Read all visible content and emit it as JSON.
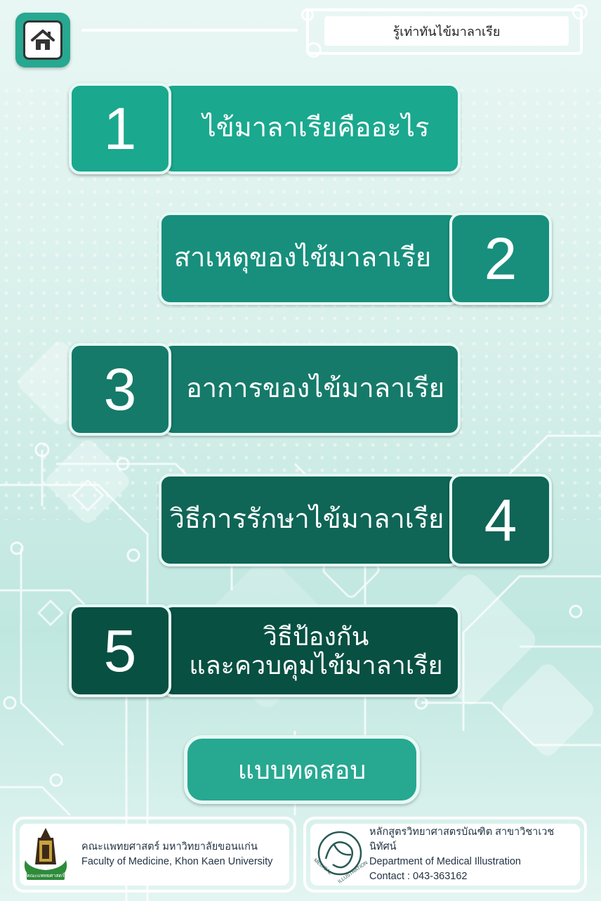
{
  "header": {
    "home_icon": "home-icon",
    "title": "รู้เท่าทันไข้มาลาเรีย"
  },
  "menu": [
    {
      "number": "1",
      "label": "ไข้มาลาเรียคืออะไร",
      "color": "#1aa88e"
    },
    {
      "number": "2",
      "label": "สาเหตุของไข้มาลาเรีย",
      "color": "#178f7c"
    },
    {
      "number": "3",
      "label": "อาการของไข้มาลาเรีย",
      "color": "#157a69"
    },
    {
      "number": "4",
      "label": "วิธีการรักษาไข้มาลาเรีย",
      "color": "#0f6556"
    },
    {
      "number": "5",
      "label_line1": "วิธีป้องกัน",
      "label_line2": "และควบคุมไข้มาลาเรีย",
      "color": "#075042"
    }
  ],
  "quiz": {
    "label": "แบบทดสอบ",
    "color": "#27a891"
  },
  "footer": {
    "left": {
      "line1": "คณะแพทยศาสตร์ มหาวิทยาลัยขอนแก่น",
      "line2": "Faculty of Medicine, Khon Kaen University",
      "logo_text": "คณะแพทยศาสตร์"
    },
    "right": {
      "line1": "หลักสูตรวิทยาศาสตรบัณฑิต สาขาวิชาเวชนิทัศน์",
      "line2": "Department of Medical Illustration",
      "line3": "Contact : 043-363162",
      "logo_top": "MEDICAL",
      "logo_bottom": "ILLUSTRATION"
    }
  }
}
